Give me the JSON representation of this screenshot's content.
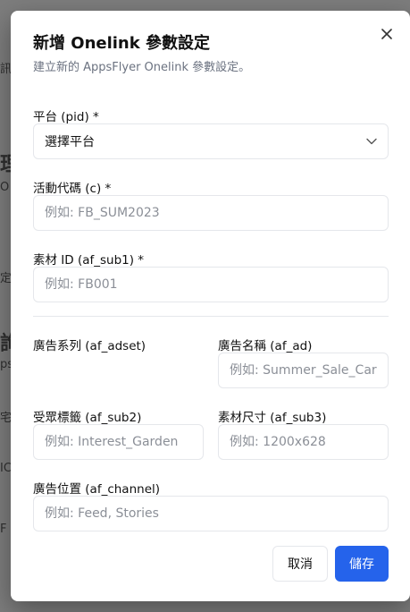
{
  "background": {
    "fragments": [
      "訊",
      "理",
      "O",
      "定",
      "詢",
      "ps",
      "宅",
      "IC",
      "F"
    ]
  },
  "dialog": {
    "title": "新增 Onelink 參數設定",
    "subtitle": "建立新的 AppsFlyer Onelink 參數設定。",
    "close_icon": "close-icon",
    "fields": {
      "platform": {
        "label": "平台 (pid) *",
        "value": "選擇平台"
      },
      "campaign": {
        "label": "活動代碼 (c) *",
        "placeholder": "例如: FB_SUM2023"
      },
      "creative_id": {
        "label": "素材 ID (af_sub1) *",
        "placeholder": "例如: FB001"
      },
      "adset": {
        "label": "廣告系列 (af_adset)"
      },
      "ad_name": {
        "label": "廣告名稱 (af_ad)",
        "placeholder": "例如: Summer_Sale_Carousel"
      },
      "audience": {
        "label": "受眾標籤 (af_sub2)",
        "placeholder": "例如: Interest_Garden"
      },
      "creative_size": {
        "label": "素材尺寸 (af_sub3)",
        "placeholder": "例如: 1200x628"
      },
      "placement": {
        "label": "廣告位置 (af_channel)",
        "placeholder": "例如: Feed, Stories"
      }
    },
    "buttons": {
      "cancel": "取消",
      "save": "儲存"
    },
    "colors": {
      "primary": "#2563eb",
      "border": "#e5e7eb",
      "muted": "#6b7280"
    }
  }
}
